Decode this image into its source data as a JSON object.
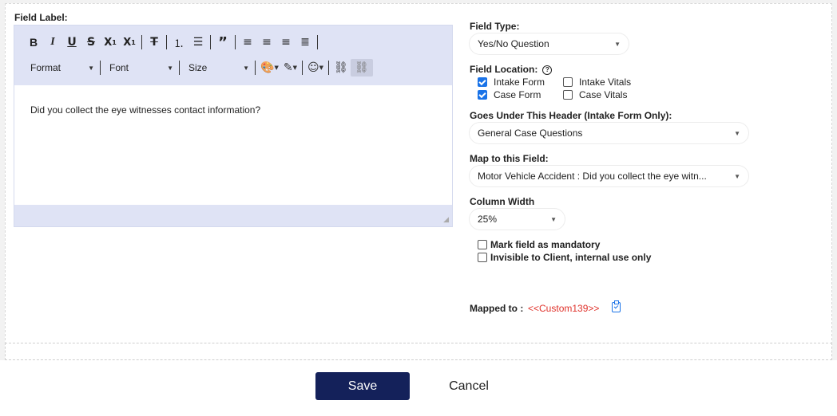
{
  "field_label": {
    "title": "Field Label:"
  },
  "editor": {
    "toolbar_row1": [
      "B",
      "I",
      "U",
      "S",
      "X₁",
      "X¹",
      "T̸",
      "≡",
      "☰",
      "❞",
      "≣",
      "≡",
      "≣",
      "≣"
    ],
    "format_label": "Format",
    "font_label": "Font",
    "size_label": "Size",
    "content": "Did you collect the eye witnesses contact information?"
  },
  "field_type": {
    "label": "Field Type:",
    "value": "Yes/No Question"
  },
  "field_location": {
    "label": "Field Location:",
    "options": [
      {
        "label": "Intake Form",
        "checked": true
      },
      {
        "label": "Intake Vitals",
        "checked": false
      },
      {
        "label": "Case Form",
        "checked": true
      },
      {
        "label": "Case Vitals",
        "checked": false
      }
    ]
  },
  "header": {
    "label": "Goes Under This Header (Intake Form Only):",
    "value": "General Case Questions"
  },
  "map_field": {
    "label": "Map to this Field:",
    "value": "Motor Vehicle Accident : Did you collect the eye witn..."
  },
  "column_width": {
    "label": "Column Width",
    "value": "25%"
  },
  "mandatory": {
    "label": "Mark field as mandatory",
    "checked": false
  },
  "invisible": {
    "label": "Invisible to Client, internal use only",
    "checked": false
  },
  "mapped": {
    "label": "Mapped to :",
    "value": "<<Custom139>>"
  },
  "actions": {
    "save": "Save",
    "cancel": "Cancel"
  },
  "colors": {
    "primary_button": "#14215a",
    "accent": "#1a73e8",
    "mapped_value": "#e0322b",
    "toolbar_bg": "#dfe3f5"
  }
}
